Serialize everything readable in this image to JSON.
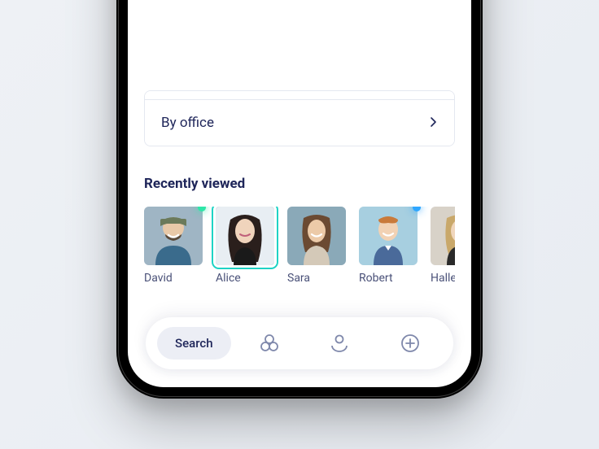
{
  "filters": {
    "by_office_label": "By office"
  },
  "section": {
    "recently_viewed_heading": "Recently viewed"
  },
  "people": [
    {
      "name": "David",
      "status": "green",
      "selected": false
    },
    {
      "name": "Alice",
      "status": null,
      "selected": true
    },
    {
      "name": "Sara",
      "status": null,
      "selected": false
    },
    {
      "name": "Robert",
      "status": "blue",
      "selected": false
    },
    {
      "name": "Halle",
      "status": null,
      "selected": false
    }
  ],
  "nav": {
    "search_label": "Search"
  },
  "colors": {
    "primary_text": "#1e2559",
    "accent": "#1ed3c5",
    "status_green": "#2ee6a8",
    "status_blue": "#2ea6ff"
  }
}
